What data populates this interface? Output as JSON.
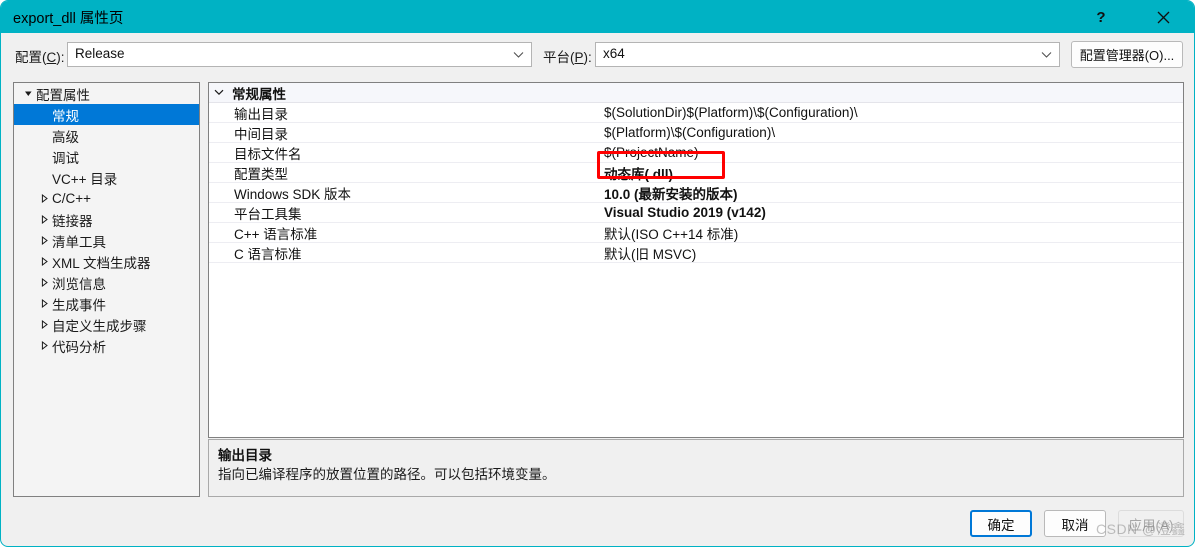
{
  "window": {
    "title": "export_dll 属性页",
    "help_label": "?",
    "close_label": "×",
    "accent_color": "#00b2c4",
    "selection_color": "#0078d7"
  },
  "config_bar": {
    "config_label_pre": "配置(",
    "config_label_key": "C",
    "config_label_post": "):",
    "config_value": "Release",
    "platform_label_pre": "平台(",
    "platform_label_key": "P",
    "platform_label_post": "):",
    "platform_value": "x64",
    "config_manager_button": "配置管理器(O)..."
  },
  "sidebar": {
    "items": [
      {
        "label": "配置属性",
        "level": 0,
        "expanded": true,
        "selected": false,
        "has_children": true
      },
      {
        "label": "常规",
        "level": 1,
        "expanded": false,
        "selected": true,
        "has_children": false
      },
      {
        "label": "高级",
        "level": 1,
        "expanded": false,
        "selected": false,
        "has_children": false
      },
      {
        "label": "调试",
        "level": 1,
        "expanded": false,
        "selected": false,
        "has_children": false
      },
      {
        "label": "VC++ 目录",
        "level": 1,
        "expanded": false,
        "selected": false,
        "has_children": false
      },
      {
        "label": "C/C++",
        "level": 1,
        "expanded": false,
        "selected": false,
        "has_children": true
      },
      {
        "label": "链接器",
        "level": 1,
        "expanded": false,
        "selected": false,
        "has_children": true
      },
      {
        "label": "清单工具",
        "level": 1,
        "expanded": false,
        "selected": false,
        "has_children": true
      },
      {
        "label": "XML 文档生成器",
        "level": 1,
        "expanded": false,
        "selected": false,
        "has_children": true
      },
      {
        "label": "浏览信息",
        "level": 1,
        "expanded": false,
        "selected": false,
        "has_children": true
      },
      {
        "label": "生成事件",
        "level": 1,
        "expanded": false,
        "selected": false,
        "has_children": true
      },
      {
        "label": "自定义生成步骤",
        "level": 1,
        "expanded": false,
        "selected": false,
        "has_children": true
      },
      {
        "label": "代码分析",
        "level": 1,
        "expanded": false,
        "selected": false,
        "has_children": true
      }
    ]
  },
  "property_grid": {
    "category": "常规属性",
    "rows": [
      {
        "name": "输出目录",
        "value": "$(SolutionDir)$(Platform)\\$(Configuration)\\",
        "bold": false
      },
      {
        "name": "中间目录",
        "value": "$(Platform)\\$(Configuration)\\",
        "bold": false
      },
      {
        "name": "目标文件名",
        "value": "$(ProjectName)",
        "bold": false
      },
      {
        "name": "配置类型",
        "value": "动态库(.dll)",
        "bold": true
      },
      {
        "name": "Windows SDK 版本",
        "value": "10.0 (最新安装的版本)",
        "bold": true
      },
      {
        "name": "平台工具集",
        "value": "Visual Studio 2019 (v142)",
        "bold": true
      },
      {
        "name": "C++ 语言标准",
        "value": "默认(ISO C++14 标准)",
        "bold": false
      },
      {
        "name": "C 语言标准",
        "value": "默认(旧 MSVC)",
        "bold": false
      }
    ]
  },
  "description": {
    "title": "输出目录",
    "text": "指向已编译程序的放置位置的路径。可以包括环境变量。"
  },
  "footer": {
    "ok_label": "确定",
    "cancel_label": "取消",
    "apply_label": "应用(A)"
  },
  "annotation": {
    "color": "#ff0000",
    "target_value": "动态库(.dll)"
  },
  "watermark": {
    "text": "CSDN @澄鑫"
  }
}
